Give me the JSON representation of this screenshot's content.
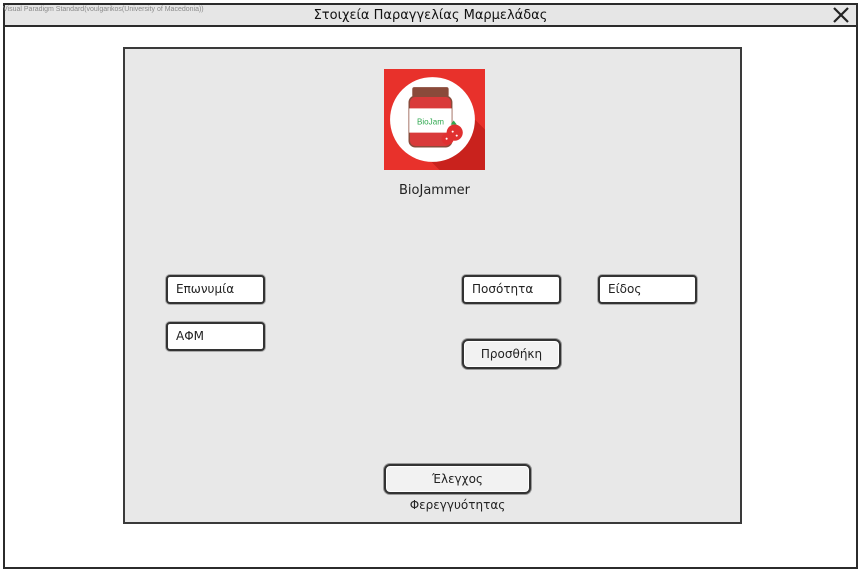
{
  "window": {
    "title": "Στοιχεία Παραγγελίας Μαρμελάδας",
    "watermark": "Visual Paradigm Standard(voulgarikos(University of Macedonia))",
    "close_icon": "close-icon"
  },
  "brand": {
    "logo_text": "BioJam",
    "name": "BioJammer",
    "colors": {
      "logo_bg": "#e8312b",
      "jar_label": "#2fa84f"
    }
  },
  "form": {
    "company_field": "Επωνυμία",
    "vat_field": "ΑΦΜ",
    "quantity_field": "Ποσότητα",
    "type_field": "Είδος",
    "add_button": "Προσθήκη",
    "check_button": "Έλεγχος Φερεγγυότητας"
  }
}
